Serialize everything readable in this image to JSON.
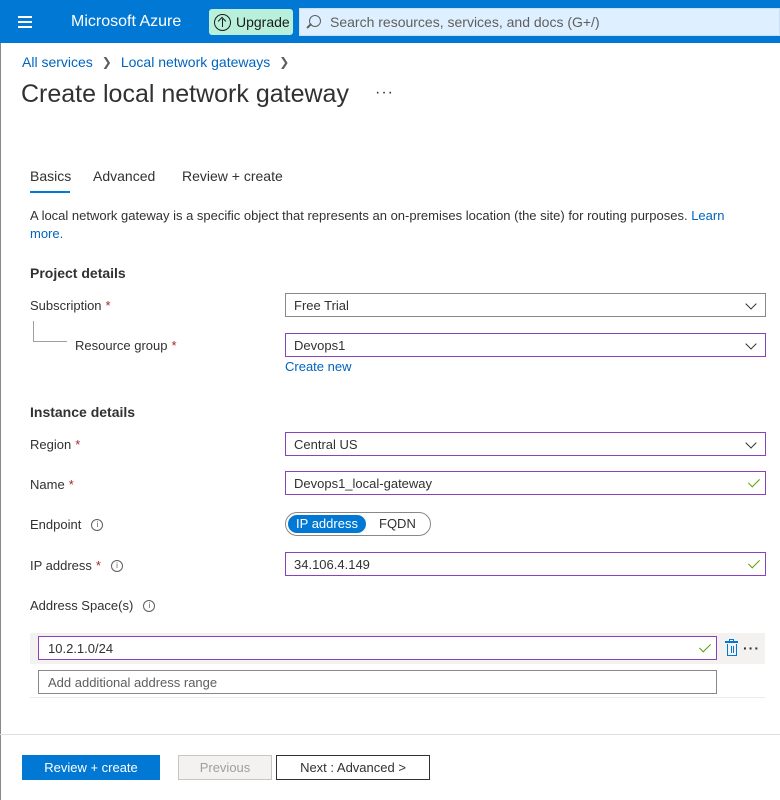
{
  "header": {
    "brand": "Microsoft Azure",
    "upgrade_label": "Upgrade",
    "search_placeholder": "Search resources, services, and docs (G+/)"
  },
  "breadcrumb": [
    "All services",
    "Local network gateways"
  ],
  "page": {
    "title": "Create local network gateway",
    "more": "···"
  },
  "tabs": [
    "Basics",
    "Advanced",
    "Review + create"
  ],
  "description": {
    "text": "A local network gateway is a specific object that represents an on-premises location (the site) for routing purposes.",
    "link": "Learn more."
  },
  "project_details": {
    "heading": "Project details",
    "subscription_label": "Subscription",
    "subscription_value": "Free Trial",
    "resource_group_label": "Resource group",
    "resource_group_value": "Devops1",
    "create_new": "Create new"
  },
  "instance_details": {
    "heading": "Instance details",
    "region_label": "Region",
    "region_value": "Central US",
    "name_label": "Name",
    "name_value": "Devops1_local-gateway",
    "endpoint_label": "Endpoint",
    "endpoint_options": [
      "IP address",
      "FQDN"
    ],
    "endpoint_selected": "IP address",
    "ip_label": "IP address",
    "ip_value": "34.106.4.149",
    "address_space_label": "Address Space(s)",
    "address_ranges": [
      "10.2.1.0/24"
    ],
    "add_range_placeholder": "Add additional address range"
  },
  "required_marker": "*",
  "info_glyph": "i",
  "footer": {
    "primary": "Review + create",
    "previous": "Previous",
    "next": "Next : Advanced >"
  }
}
